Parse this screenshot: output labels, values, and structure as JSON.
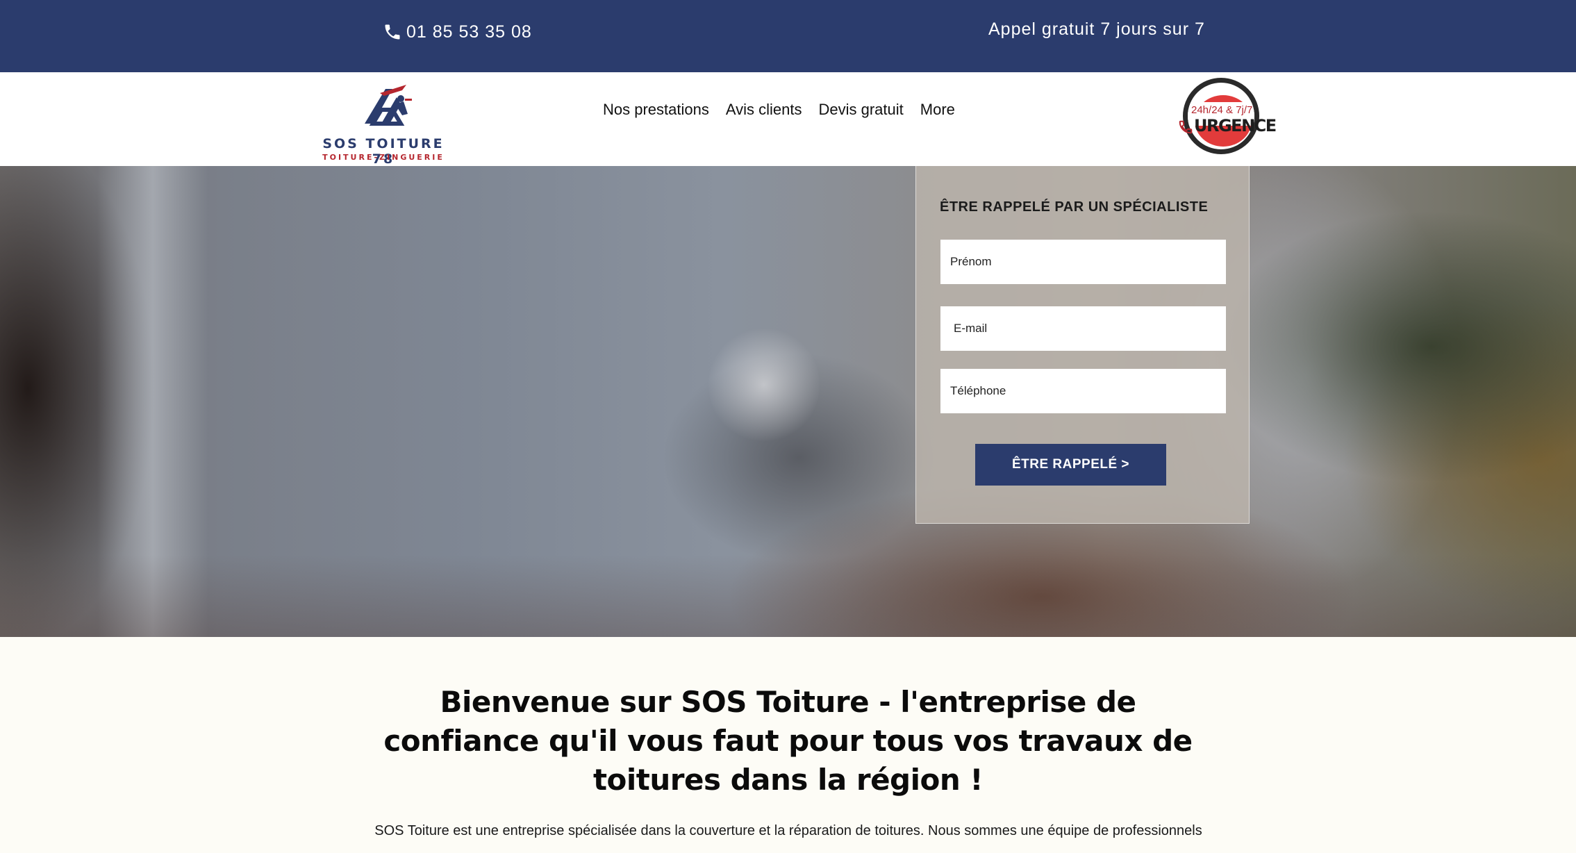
{
  "topbar": {
    "phone_icon": "phone-icon",
    "phone": "01 85 53 35 08",
    "free_call": "Appel gratuit 7 jours sur 7"
  },
  "header": {
    "logo": {
      "name": "SOS TOITURE 78",
      "subtitle": "TOITURE-ZINGUERIE"
    },
    "nav": [
      "Nos prestations",
      "Avis clients",
      "Devis gratuit",
      "More"
    ],
    "urgence": {
      "hours": "24h/24 & 7j/7",
      "label": "URGENCE"
    }
  },
  "form": {
    "title": "ÊTRE RAPPELÉ PAR UN SPÉCIALISTE",
    "first_name_placeholder": "Prénom",
    "email_placeholder": "E-mail",
    "phone_placeholder": "Téléphone",
    "submit": "ÊTRE RAPPELÉ >"
  },
  "welcome": {
    "heading": "Bienvenue sur SOS Toiture - l'entreprise de confiance qu'il vous faut pour tous vos travaux de toitures dans la région !",
    "intro": "SOS Toiture est une entreprise spécialisée dans la couverture et la réparation de toitures. Nous sommes une équipe de professionnels"
  },
  "colors": {
    "brand_blue": "#2b3c6d",
    "brand_red": "#b5262e",
    "urgence_red": "#e23b3b",
    "page_bg": "#fdfcf6"
  }
}
